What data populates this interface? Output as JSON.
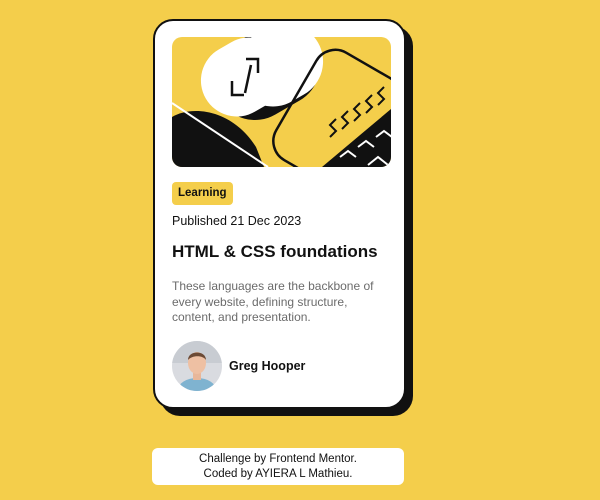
{
  "page": {
    "background_color": "#f4ce4b"
  },
  "card": {
    "tag": "Learning",
    "published": "Published 21 Dec 2023",
    "title": "HTML & CSS foundations",
    "description": "These languages are the backbone of every website, defining structure, content, and presentation.",
    "author_name": "Greg Hooper",
    "avatar_icon": "avatar-photo",
    "illustration_icon": "abstract-illustration",
    "accent_color": "#f4ce4b",
    "shadow_color": "#111111"
  },
  "attribution": {
    "line1": "Challenge by Frontend Mentor.",
    "line2": "Coded by AYIERA L Mathieu."
  }
}
